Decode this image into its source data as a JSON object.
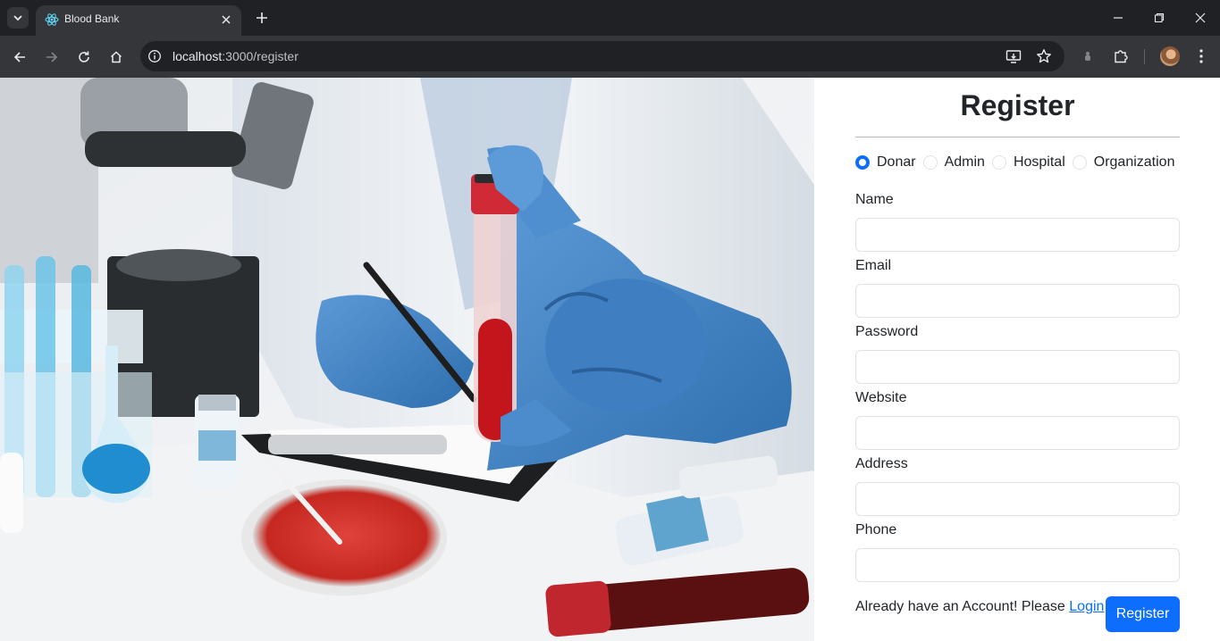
{
  "browser": {
    "tab_title": "Blood Bank",
    "url_host": "localhost",
    "url_path": ":3000/register"
  },
  "form": {
    "title": "Register",
    "roles": [
      {
        "label": "Donar",
        "checked": true
      },
      {
        "label": "Admin",
        "checked": false
      },
      {
        "label": "Hospital",
        "checked": false
      },
      {
        "label": "Organization",
        "checked": false
      }
    ],
    "fields": {
      "name_label": "Name",
      "name_value": "",
      "email_label": "Email",
      "email_value": "",
      "password_label": "Password",
      "password_value": "",
      "website_label": "Website",
      "website_value": "",
      "address_label": "Address",
      "address_value": "",
      "phone_label": "Phone",
      "phone_value": ""
    },
    "footer_text": "Already have an Account! Please ",
    "login_link": "Login",
    "submit_label": "Register"
  },
  "colors": {
    "accent": "#0d6efd",
    "chrome_dark": "#202124",
    "chrome_toolbar": "#35363a"
  },
  "icons": [
    "tab-search-icon",
    "react-favicon-icon",
    "close-icon",
    "plus-icon",
    "minimize-icon",
    "restore-icon",
    "back-icon",
    "forward-icon",
    "reload-icon",
    "home-icon",
    "site-info-icon",
    "install-app-icon",
    "star-icon",
    "extension-puzzle-icon",
    "menu-kebab-icon"
  ]
}
